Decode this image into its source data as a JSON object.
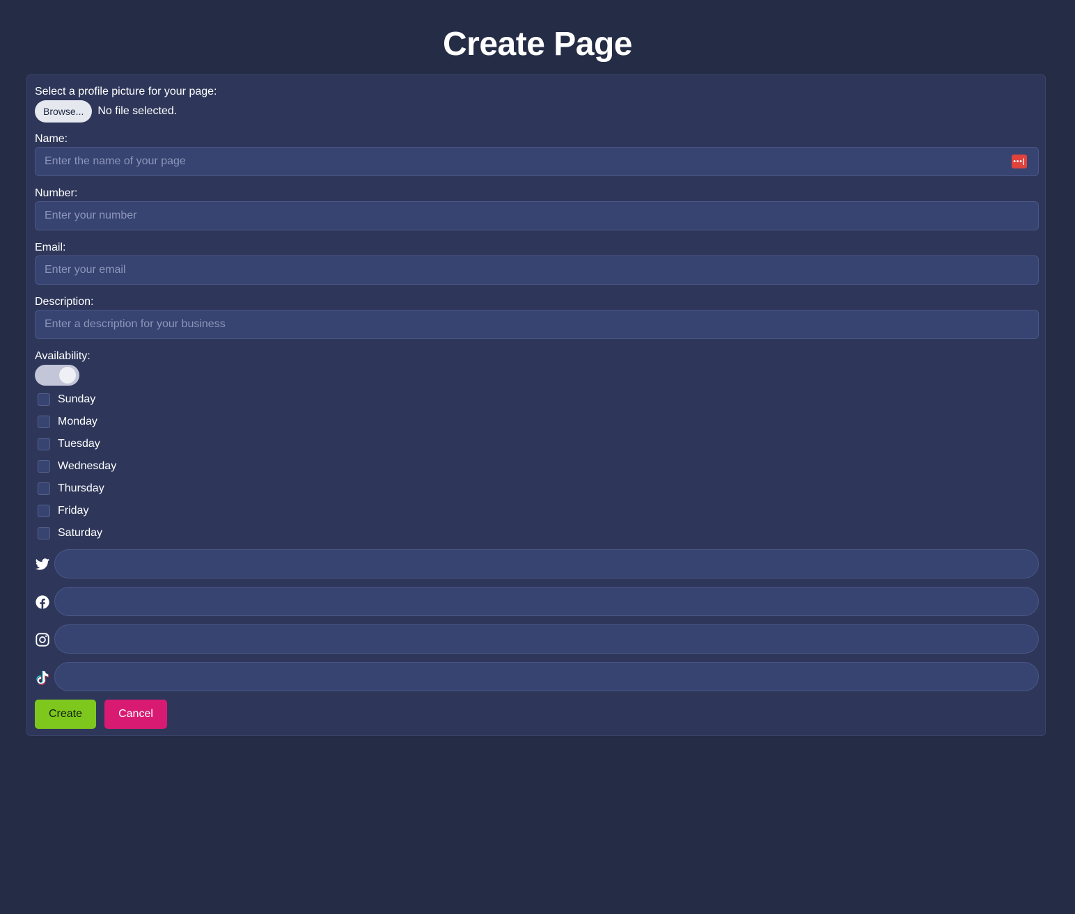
{
  "header": {
    "title": "Create Page"
  },
  "profile_picture": {
    "label": "Select a profile picture for your page:",
    "browse_label": "Browse...",
    "status": "No file selected."
  },
  "fields": {
    "name": {
      "label": "Name:",
      "placeholder": "Enter the name of your page",
      "value": ""
    },
    "number": {
      "label": "Number:",
      "placeholder": "Enter your number",
      "value": ""
    },
    "email": {
      "label": "Email:",
      "placeholder": "Enter your email",
      "value": ""
    },
    "description": {
      "label": "Description:",
      "placeholder": "Enter a description for your business",
      "value": ""
    }
  },
  "availability": {
    "label": "Availability:",
    "toggle_on": true,
    "days": [
      {
        "label": "Sunday",
        "checked": false
      },
      {
        "label": "Monday",
        "checked": false
      },
      {
        "label": "Tuesday",
        "checked": false
      },
      {
        "label": "Wednesday",
        "checked": false
      },
      {
        "label": "Thursday",
        "checked": false
      },
      {
        "label": "Friday",
        "checked": false
      },
      {
        "label": "Saturday",
        "checked": false
      }
    ]
  },
  "socials": [
    {
      "icon": "twitter-icon",
      "value": ""
    },
    {
      "icon": "facebook-icon",
      "value": ""
    },
    {
      "icon": "instagram-icon",
      "value": ""
    },
    {
      "icon": "tiktok-icon",
      "value": ""
    }
  ],
  "actions": {
    "create_label": "Create",
    "cancel_label": "Cancel"
  },
  "colors": {
    "background": "#252c45",
    "card": "#2e375a",
    "input": "#374472",
    "create": "#7ec81d",
    "cancel": "#d91a72",
    "password_manager": "#e0423c"
  }
}
